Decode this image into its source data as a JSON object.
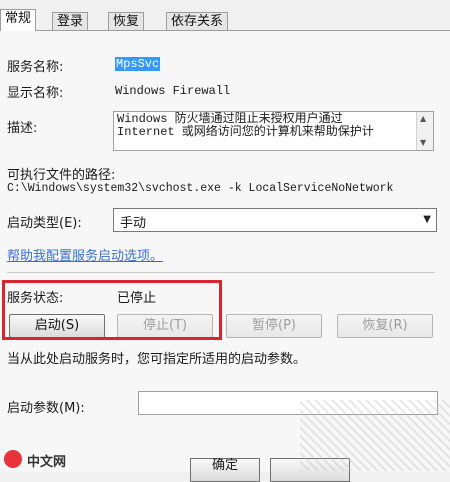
{
  "tabs": [
    {
      "label": "常规",
      "active": true
    },
    {
      "label": "登录",
      "active": false
    },
    {
      "label": "恢复",
      "active": false
    },
    {
      "label": "依存关系",
      "active": false
    }
  ],
  "service_name": {
    "label": "服务名称:",
    "value": "MpsSvc"
  },
  "display_name": {
    "label": "显示名称:",
    "value": "Windows Firewall"
  },
  "description": {
    "label": "描述:",
    "line1": "Windows 防火墙通过阻止未授权用户通过",
    "line2": "Internet 或网络访问您的计算机来帮助保护计"
  },
  "exec_path": {
    "label": "可执行文件的路径:",
    "value": "C:\\Windows\\system32\\svchost.exe -k LocalServiceNoNetwork"
  },
  "startup_type": {
    "label": "启动类型(E):",
    "value": "手动"
  },
  "help_link": "帮助我配置服务启动选项。",
  "service_status": {
    "label": "服务状态:",
    "value": "已停止"
  },
  "buttons": {
    "start": "启动(S)",
    "stop": "停止(T)",
    "pause": "暂停(P)",
    "resume": "恢复(R)"
  },
  "hint": "当从此处启动服务时，您可指定所适用的启动参数。",
  "start_params": {
    "label": "启动参数(M):",
    "value": ""
  },
  "footer": {
    "ok": "确定"
  },
  "watermark": {
    "text": "中文网"
  },
  "colors": {
    "highlight_border": "#d9262c",
    "link": "#3b6fd3",
    "selection": "#3399ff"
  }
}
